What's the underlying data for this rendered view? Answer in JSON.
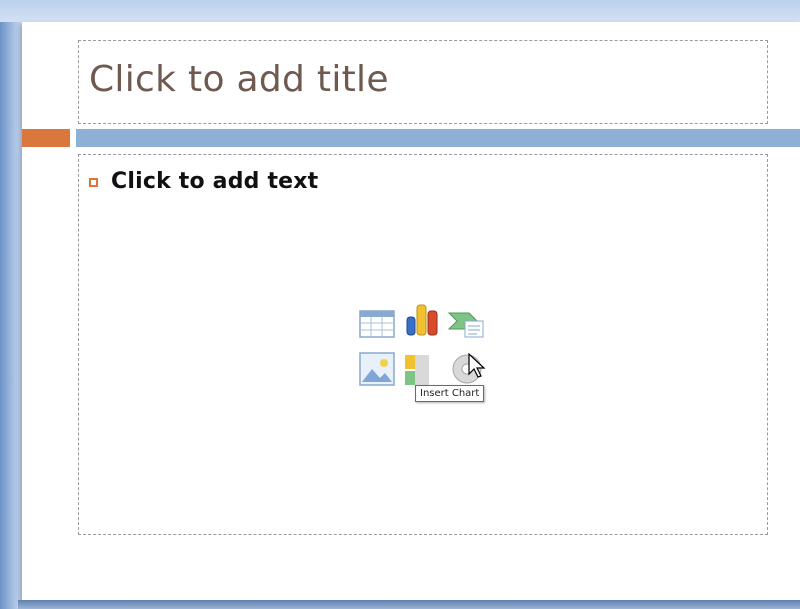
{
  "slide": {
    "title_placeholder": "Click to add title",
    "body_placeholder": "Click to add text"
  },
  "content_icons": [
    {
      "name": "insert-table-icon"
    },
    {
      "name": "insert-chart-icon"
    },
    {
      "name": "insert-smartart-icon"
    },
    {
      "name": "insert-picture-icon"
    },
    {
      "name": "insert-clipart-icon"
    },
    {
      "name": "insert-media-icon"
    }
  ],
  "tooltip": "Insert Chart",
  "colors": {
    "accent_orange": "#d9773c",
    "accent_blue": "#8fb0d6",
    "title_text": "#6e5a50"
  }
}
